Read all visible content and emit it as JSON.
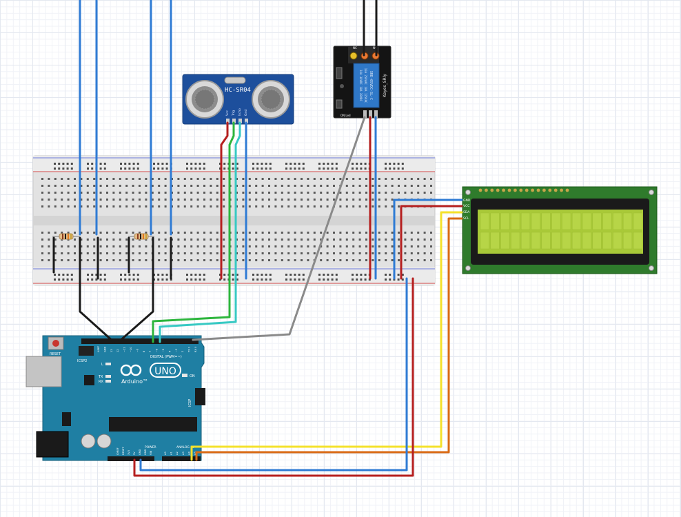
{
  "sensor": {
    "label": "HC-SR04",
    "pins": [
      "Vcc",
      "Trig",
      "Echo",
      "Gnd"
    ]
  },
  "relay": {
    "brand": "Keyes_SRly",
    "part": "SRD-05VDC-SL-C",
    "specs": [
      "10A 250VAC  10A 125VAC",
      "10A 30VDC  10A 28VDC"
    ],
    "terminals": [
      "NC",
      "COM",
      "NO"
    ],
    "led_label": "ON Led",
    "pins": [
      "-",
      "+",
      "S"
    ]
  },
  "lcd": {
    "pins": [
      "GND",
      "VCC",
      "SDA",
      "SCL"
    ]
  },
  "arduino": {
    "reset_label": "RESET",
    "icsp2_label": "ICSP2",
    "l_label": "L",
    "tx_label": "TX",
    "rx_label": "RX",
    "on_label": "ON",
    "logo_text": "UNO",
    "brand": "Arduino™",
    "digital_label": "DIGITAL (PWM=~)",
    "icsp_label": "ICSP",
    "power_label": "POWER",
    "analog_label": "ANALOG IN",
    "top_pins": [
      "AREF",
      "GND",
      "13",
      "12",
      "~11",
      "~10",
      "~9",
      "8",
      "7",
      "~6",
      "~5",
      "4",
      "~3",
      "2",
      "TX 1",
      "RX 0"
    ],
    "power_pins": [
      "IOREF",
      "RESET",
      "3V3",
      "5V",
      "GND",
      "GND",
      "VIN"
    ],
    "analog_pins": [
      "A0",
      "A1",
      "A2",
      "A3",
      "A4",
      "A5"
    ]
  },
  "colors": {
    "blue_wire": "#2f7bd4",
    "red_wire": "#b51f1f",
    "green_wire": "#2cb53c",
    "cyan_wire": "#37c9c3",
    "black_wire": "#1a1a1a",
    "gray_wire": "#8a8a8a",
    "yellow_wire": "#f4e12b",
    "orange_wire": "#d96a14",
    "board": "#1f7fa3",
    "lcd_pcb": "#2f7b2c",
    "lcd_screen": "#a9c938"
  }
}
